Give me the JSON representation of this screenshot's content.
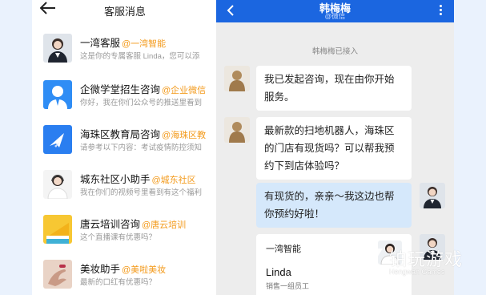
{
  "left_panel": {
    "title": "客服消息",
    "contacts": [
      {
        "name": "一湾客服",
        "tag": "@一湾智能",
        "message": "这是你的专属客服 Linda，您可以添",
        "avatar": "person-woman-suit-avatar"
      },
      {
        "name": "企微学堂招生咨询",
        "tag": "@企业微信",
        "message": "你好，我在你们公众号的推送里看到",
        "avatar": "person-silhouette-avatar"
      },
      {
        "name": "海珠区教育局咨询",
        "tag": "@海珠区教",
        "message": "请参考以下内容：考试疫情防控须知",
        "avatar": "paper-plane-avatar"
      },
      {
        "name": "城东社区小助手",
        "tag": "@城东社区",
        "message": "我在你们的视频号里看到有这个福利",
        "avatar": "person-headset-avatar"
      },
      {
        "name": "唐云培训咨询",
        "tag": "@唐云培训",
        "message": "这个直播课有优惠吗？",
        "avatar": "yellow-book-avatar"
      },
      {
        "name": "美妆助手",
        "tag": "@美啦美妆",
        "message": "最新的口红有优惠吗？",
        "avatar": "hand-avatar"
      }
    ]
  },
  "chat": {
    "title": "韩梅梅",
    "subtitle": "@微信",
    "system_notice": "韩梅梅已接入",
    "messages": [
      {
        "from": "customer",
        "lines": [
          "我已发起咨询，现在由你开始",
          "服务。"
        ]
      },
      {
        "from": "customer",
        "lines": [
          "最新款的扫地机器人，海珠区",
          "的门店有现货吗？可以帮我预",
          "约下到店体验吗？"
        ]
      },
      {
        "from": "agent",
        "lines": [
          "有现货的，亲亲～我这边也帮",
          "你预约好啦！"
        ]
      }
    ],
    "card": {
      "company": "一湾智能",
      "name": "Linda",
      "role": "销售一组员工"
    }
  },
  "watermark": {
    "text": "铂玩游戏",
    "sub": "Hengwan Games"
  },
  "colors": {
    "header_blue": "#1b66e0",
    "tag_orange": "#f39a1b",
    "agent_bubble": "#d5e8fb"
  }
}
